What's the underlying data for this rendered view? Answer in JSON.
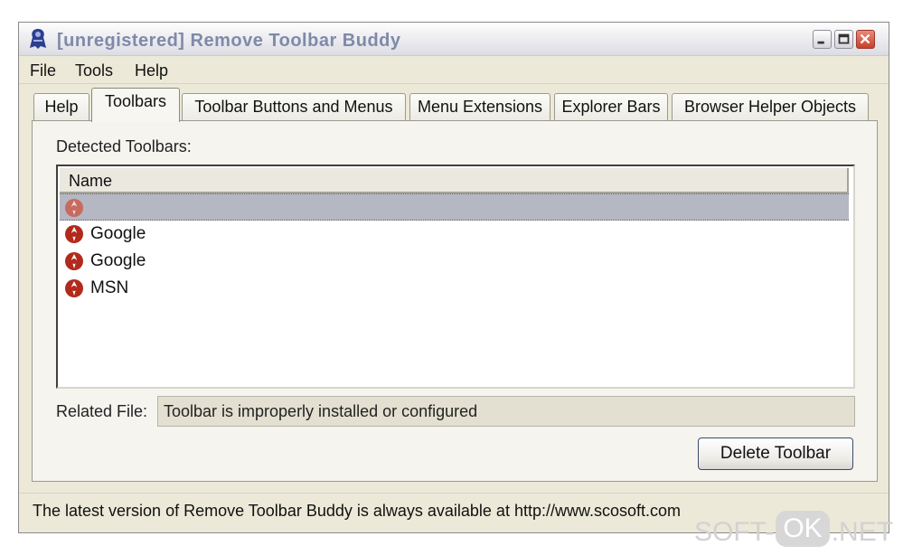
{
  "window": {
    "title": "[unregistered] Remove Toolbar Buddy",
    "icon": "app-icon",
    "controls": {
      "minimize": "minimize-icon",
      "maximize": "maximize-icon",
      "close": "close-icon"
    }
  },
  "menu": {
    "items": [
      {
        "label": "File"
      },
      {
        "label": "Tools"
      },
      {
        "label": "Help"
      }
    ]
  },
  "tabs": {
    "items": [
      {
        "label": "Help"
      },
      {
        "label": "Toolbars"
      },
      {
        "label": "Toolbar Buttons and Menus"
      },
      {
        "label": "Menu Extensions"
      },
      {
        "label": "Explorer Bars"
      },
      {
        "label": "Browser Helper Objects"
      }
    ],
    "active": "Toolbars"
  },
  "panel": {
    "detected_label": "Detected Toolbars:",
    "list": {
      "column": "Name",
      "rows": [
        {
          "label": "",
          "icon": "toolbar-icon",
          "selected": true
        },
        {
          "label": "Google",
          "icon": "toolbar-icon",
          "selected": false
        },
        {
          "label": "Google",
          "icon": "toolbar-icon",
          "selected": false
        },
        {
          "label": "MSN",
          "icon": "toolbar-icon",
          "selected": false
        }
      ]
    },
    "related_label": "Related File:",
    "related_value": "Toolbar is improperly installed or configured",
    "delete_button": "Delete Toolbar"
  },
  "status": {
    "text": "The latest version of Remove Toolbar Buddy is always available at http://www.scosoft.com"
  },
  "watermark": {
    "part1": "SOFT-",
    "part2": "OK",
    "part3": ".NET"
  },
  "colors": {
    "window_bg": "#ece9d8",
    "selection": "#b5b7c2",
    "icon_red": "#b22a1c"
  }
}
